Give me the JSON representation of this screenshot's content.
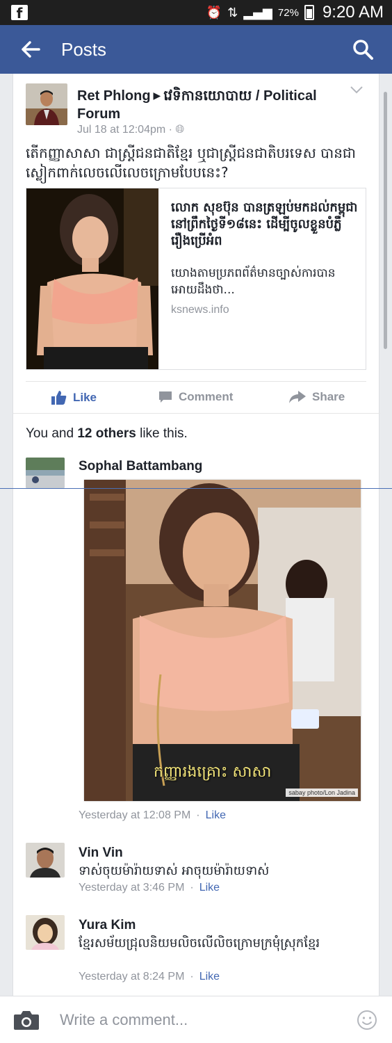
{
  "status_bar": {
    "app_icon": "facebook-notification-icon",
    "battery_pct": "72%",
    "time": "9:20 AM",
    "icons": [
      "alarm-icon",
      "data-transfer-icon",
      "signal-icon",
      "battery-icon"
    ]
  },
  "app_bar": {
    "title": "Posts",
    "background": "#3b5998"
  },
  "post": {
    "author": "Ret Phlong",
    "group": "វេទិកានយោបាយ / Political Forum",
    "timestamp": "Jul 18 at 12:04pm",
    "text": "តើកញ្ញាសាសា ជាស្ត្រីជនជាតិខ្មែរ ឬជាស្ត្រីជនជាតិបរទេស បានជាស្លៀកពាក់លេចលើលេចក្រោមបែបនេះ?",
    "link": {
      "title": "លោក សុខប៊ុន បានត្រឡប់មកដល់កម្ពុជានៅព្រឹកថ្ងៃទី១៨នេះ ដើម្បីចូលខ្លួនបំភ្លឺរឿងប្រើអំព",
      "description": "យោងតាមប្រភពព័ត៌មានច្បាស់ការបានអោយដឹងថា...",
      "domain": "ksnews.info"
    },
    "actions": {
      "like": "Like",
      "comment": "Comment",
      "share": "Share"
    },
    "likes_prefix": "You and ",
    "likes_bold": "12 others",
    "likes_suffix": " like this."
  },
  "comments": [
    {
      "name": "Sophal Battambang",
      "photo_caption": "កញ្ញារងគ្រោះ សាសា",
      "photo_credit": "sabay photo/Lon Jadina",
      "time": "Yesterday at 12:08 PM",
      "like": "Like"
    },
    {
      "name": "Vin Vin",
      "text": "ទាស់ចុយម៉ារ៉ាយទាស់ អាចុយម៉ារ៉ាយទាស់",
      "time": "Yesterday at 3:46 PM",
      "like": "Like"
    },
    {
      "name": "Yura Kim",
      "text": "ខ្មែរសម័យជ្រុលនិយមលិចលើលិចក្រោមក្រមុំស្រុកខ្មែរ",
      "time": "Yesterday at 8:24 PM",
      "like": "Like"
    }
  ],
  "composer": {
    "placeholder": "Write a comment..."
  }
}
